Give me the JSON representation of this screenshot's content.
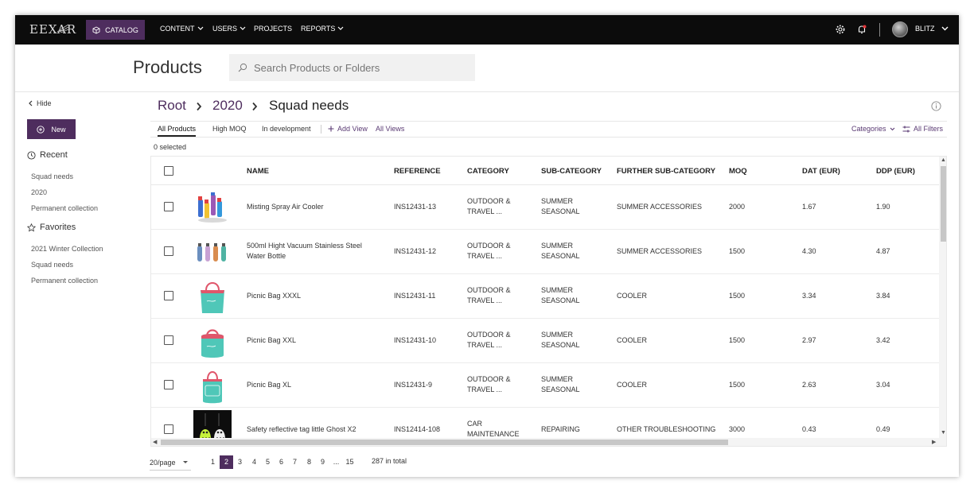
{
  "nav": {
    "logo": "EEXAR",
    "catalog": "CATALOG",
    "items": [
      "CONTENT",
      "USERS",
      "PROJECTS",
      "REPORTS"
    ],
    "user": "BLITZ"
  },
  "header": {
    "title": "Products",
    "search_placeholder": "Search Products or Folders"
  },
  "sidebar": {
    "hide": "Hide",
    "new": "New",
    "recent_label": "Recent",
    "recent": [
      "Squad needs",
      "2020",
      "Permanent collection"
    ],
    "favorites_label": "Favorites",
    "favorites": [
      "2021 Winter Collection",
      "Squad needs",
      "Permanent collection"
    ]
  },
  "breadcrumb": [
    "Root",
    "2020",
    "Squad needs"
  ],
  "tabs": [
    "All Products",
    "High MOQ",
    "In development"
  ],
  "actions": {
    "add_view": "Add View",
    "all_views": "All Views",
    "categories": "Categories",
    "all_filters": "All Filters"
  },
  "selected": "0 selected",
  "table": {
    "headers": [
      "NAME",
      "REFERENCE",
      "CATEGORY",
      "SUB-CATEGORY",
      "FURTHER SUB-CATEGORY",
      "MOQ",
      "DAT (EUR)",
      "DDP (EUR)"
    ],
    "rows": [
      {
        "name": "Misting Spray Air Cooler",
        "ref": "INS12431-13",
        "cat1": "OUTDOOR &",
        "cat2": "TRAVEL ...",
        "sub1": "SUMMER",
        "sub2": "SEASONAL",
        "further": "SUMMER ACCESSORIES",
        "moq": "2000",
        "dat": "1.67",
        "ddp": "1.90",
        "thumb": "spray-bottles"
      },
      {
        "name": "500ml Hight Vacuum Stainless Steel",
        "name2": "Water Bottle",
        "ref": "INS12431-12",
        "cat1": "OUTDOOR &",
        "cat2": "TRAVEL ...",
        "sub1": "SUMMER",
        "sub2": "SEASONAL",
        "further": "SUMMER ACCESSORIES",
        "moq": "1500",
        "dat": "4.30",
        "ddp": "4.87",
        "thumb": "bottles"
      },
      {
        "name": "Picnic Bag XXXL",
        "ref": "INS12431-11",
        "cat1": "OUTDOOR &",
        "cat2": "TRAVEL ...",
        "sub1": "SUMMER",
        "sub2": "SEASONAL",
        "further": "COOLER",
        "moq": "1500",
        "dat": "3.34",
        "ddp": "3.84",
        "thumb": "picnic-bag"
      },
      {
        "name": "Picnic Bag XXL",
        "ref": "INS12431-10",
        "cat1": "OUTDOOR &",
        "cat2": "TRAVEL ...",
        "sub1": "SUMMER",
        "sub2": "SEASONAL",
        "further": "COOLER",
        "moq": "1500",
        "dat": "2.97",
        "ddp": "3.42",
        "thumb": "picnic-bag"
      },
      {
        "name": "Picnic Bag XL",
        "ref": "INS12431-9",
        "cat1": "OUTDOOR &",
        "cat2": "TRAVEL ...",
        "sub1": "SUMMER",
        "sub2": "SEASONAL",
        "further": "COOLER",
        "moq": "1500",
        "dat": "2.63",
        "ddp": "3.04",
        "thumb": "picnic-bag"
      },
      {
        "name": "Safety reflective tag little Ghost X2",
        "ref": "INS12414-108",
        "cat1": "CAR",
        "cat2": "MAINTENANCE",
        "sub1": "REPAIRING",
        "sub2": "",
        "further": "OTHER TROUBLESHOOTING",
        "moq": "3000",
        "dat": "0.43",
        "ddp": "0.49",
        "thumb": "ghost-tags"
      }
    ]
  },
  "pagination": {
    "per_page": "20/page",
    "pages": [
      "1",
      "2",
      "3",
      "4",
      "5",
      "6",
      "7",
      "8",
      "9",
      "...",
      "15"
    ],
    "current": "2",
    "total": "287 in total"
  },
  "colors": {
    "accent": "#4e2d5e",
    "topbar": "#0c0c0c",
    "teal": "#4fc7b8"
  }
}
